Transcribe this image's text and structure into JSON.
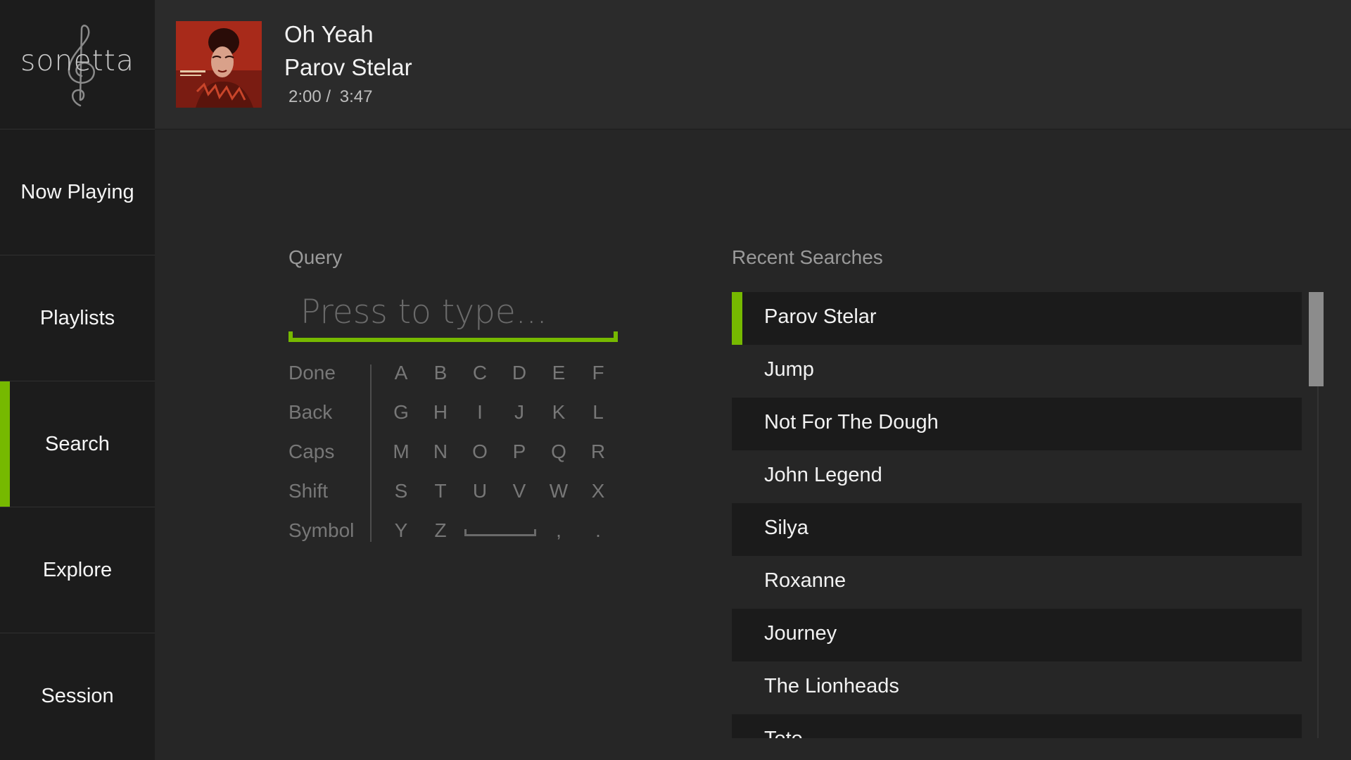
{
  "app": {
    "logo_text": "sonetta"
  },
  "colors": {
    "accent": "#76b900",
    "background": "#262626",
    "sidebar": "#1c1c1c",
    "header": "#2b2b2b"
  },
  "now_playing": {
    "title": "Oh Yeah",
    "artist": "Parov Stelar",
    "elapsed": "2:00",
    "separator": "/",
    "duration": "3:47"
  },
  "sidebar": {
    "items": [
      {
        "label": "Now Playing",
        "active": false
      },
      {
        "label": "Playlists",
        "active": false
      },
      {
        "label": "Search",
        "active": true
      },
      {
        "label": "Explore",
        "active": false
      },
      {
        "label": "Session",
        "active": false
      }
    ]
  },
  "query": {
    "label": "Query",
    "placeholder": "Press to type...",
    "value": ""
  },
  "keyboard": {
    "actions": [
      "Done",
      "Back",
      "Caps",
      "Shift",
      "Symbol"
    ],
    "rows": [
      [
        "A",
        "B",
        "C",
        "D",
        "E",
        "F"
      ],
      [
        "G",
        "H",
        "I",
        "J",
        "K",
        "L"
      ],
      [
        "M",
        "N",
        "O",
        "P",
        "Q",
        "R"
      ],
      [
        "S",
        "T",
        "U",
        "V",
        "W",
        "X"
      ],
      [
        "Y",
        "Z",
        "",
        "",
        ",",
        "."
      ]
    ],
    "space_key": "space-icon"
  },
  "recent_searches": {
    "label": "Recent Searches",
    "items": [
      "Parov Stelar",
      "Jump",
      "Not For The Dough",
      "John Legend",
      "Silya",
      "Roxanne",
      "Journey",
      "The Lionheads",
      "Toto"
    ],
    "selected_index": 0
  }
}
